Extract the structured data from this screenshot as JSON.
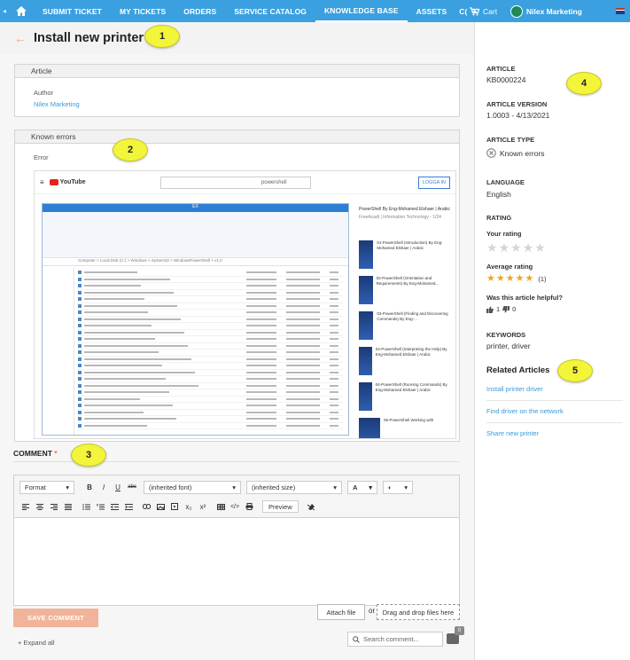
{
  "nav": {
    "items": [
      "SUBMIT TICKET",
      "MY TICKETS",
      "ORDERS",
      "SERVICE CATALOG",
      "KNOWLEDGE BASE",
      "ASSETS",
      "C("
    ],
    "active_index": 4,
    "cart_label": "Cart",
    "user_name": "Nilex Marketing",
    "home_icon": "home-icon",
    "left_arrow": "◂",
    "right_arrow": "▸"
  },
  "title": {
    "text": "Install new printer",
    "back_icon": "←"
  },
  "callouts": [
    "1",
    "2",
    "3",
    "4",
    "5"
  ],
  "article_panel": {
    "heading": "Article",
    "author_label": "Author",
    "author_value": "Nilex Marketing"
  },
  "errors_panel": {
    "heading": "Known errors",
    "error_label": "Error",
    "screenshot": {
      "yt_brand": "YouTube",
      "yt_search": "powershell",
      "yt_login": "LOGGA IN",
      "explorer_title": "EX",
      "explorer_address": "Computer > Local Disk (C:) > Windows > System32 > WindowsPowerShell > v1.0",
      "playlist_title": "PowerShell By Eng-Mohamed Elshaer | Arabic",
      "playlist_channel": "FreeAcadt | Information Technology - 1/24",
      "videos": [
        "01-PowerShell (Introduction) By Eng-Mohamed Elshaer | Arabic",
        "02-PowerShell (Orientation and Requirements) By Eng-Mohamed...",
        "03-PowerShell (Finding and Discovering Commands) By Eng-...",
        "04-PowerShell (Interpreting the Help) By Eng-Mohamed Elshaer | Arabic",
        "04-PowerShell (Running Commands) By Eng-Mohamed Elshaer | Arabic",
        "05-PowerShell Working with"
      ]
    }
  },
  "comment": {
    "label": "COMMENT",
    "required_mark": "*",
    "format_select": "Format",
    "font_select": "(inherited font)",
    "size_select": "(inherited size)",
    "color_btn": "A",
    "bg_btn": "◐",
    "bold": "B",
    "italic": "I",
    "underline": "U",
    "strike": "abc",
    "subscript": "x₂",
    "superscript": "x²",
    "preview_btn": "Preview",
    "save_btn": "SAVE COMMENT",
    "attach_btn": "Attach file",
    "or_text": "or",
    "dropzone": "Drag and drop files here",
    "expand_all": "+ Expand all",
    "search_placeholder": "Search comment...",
    "comment_count": "0"
  },
  "sidebar": {
    "article_label": "ARTICLE",
    "article_value": "KB0000224",
    "version_label": "ARTICLE VERSION",
    "version_value": "1.0003 - 4/13/2021",
    "type_label": "ARTICLE TYPE",
    "type_value": "Known errors",
    "language_label": "LANGUAGE",
    "language_value": "English",
    "rating_label": "RATING",
    "your_rating_label": "Your rating",
    "your_rating_stars": 0,
    "average_rating_label": "Average rating",
    "average_rating": 5,
    "average_count": "(1)",
    "helpful_label": "Was this article helpful?",
    "helpful_up_count": "1",
    "helpful_down_count": "0",
    "keywords_label": "KEYWORDS",
    "keywords_value": "printer, driver",
    "related_title": "Related Articles",
    "related": [
      "Install printer driver",
      "Find driver on the network",
      "Share new printer"
    ]
  }
}
